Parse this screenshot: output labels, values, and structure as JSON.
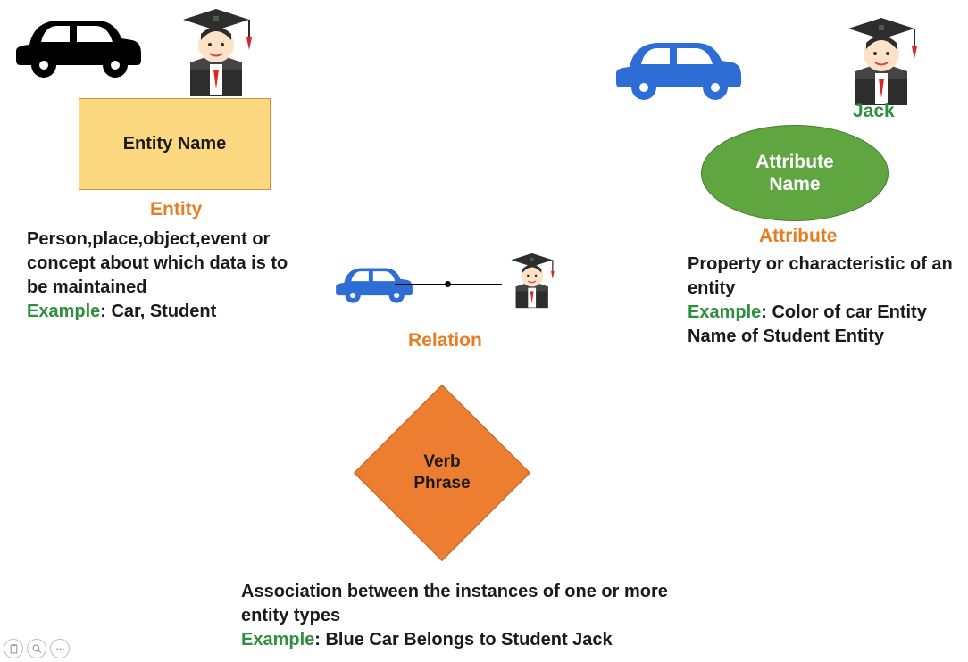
{
  "entity": {
    "shape_label": "Entity Name",
    "title": "Entity",
    "desc": "Person,place,object,event or concept about which data is to be maintained",
    "example_label": "Example",
    "example_text": ": Car, Student"
  },
  "relation": {
    "shape_label": "Verb\nPhrase",
    "title": "Relation",
    "desc": "Association between the instances of one or more entity types",
    "example_label": "Example",
    "example_text": ": Blue Car Belongs to Student Jack"
  },
  "attribute": {
    "shape_label": "Attribute\nName",
    "title": "Attribute",
    "jack_label": "Jack",
    "desc": "Property or characteristic of an entity",
    "example_label": "Example",
    "example_text": ": Color of car Entity Name of Student Entity"
  },
  "colors": {
    "orange": "#e67e22",
    "green": "#2e8f3d",
    "entity_fill": "#fcd981",
    "attr_fill": "#5fa641",
    "rel_fill": "#ed7d31",
    "car_black": "#000000",
    "car_blue": "#2e6cd6"
  }
}
